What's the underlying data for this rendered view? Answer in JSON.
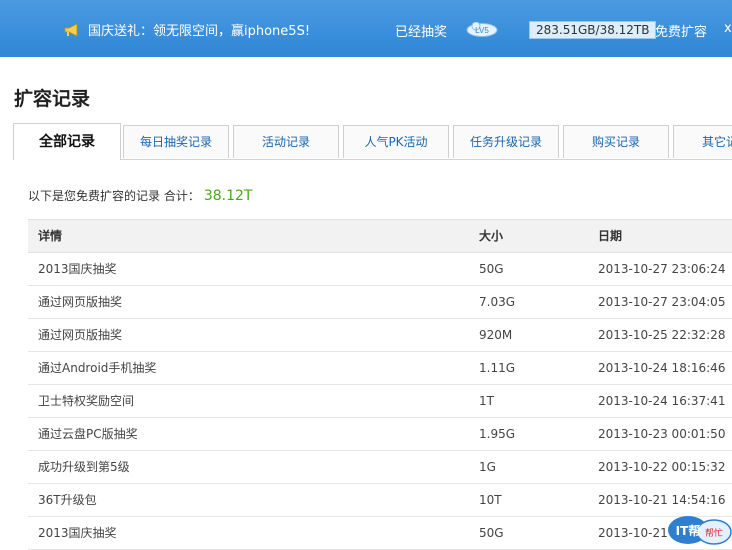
{
  "topbar": {
    "promo_text": "国庆送礼：领无限空间，赢iphone5S!",
    "lottery_done": "已经抽奖",
    "level": "LV5",
    "capacity": "283.51GB/38.12TB",
    "free_expand": "免费扩容",
    "user_partial": "x"
  },
  "page": {
    "title": "扩容记录"
  },
  "tabs": [
    {
      "label": "全部记录"
    },
    {
      "label": "每日抽奖记录"
    },
    {
      "label": "活动记录"
    },
    {
      "label": "人气PK活动"
    },
    {
      "label": "任务升级记录"
    },
    {
      "label": "购买记录"
    },
    {
      "label": "其它记"
    }
  ],
  "summary": {
    "text": "以下是您免费扩容的记录  合计：",
    "total": "38.12T"
  },
  "table": {
    "headers": [
      "详情",
      "大小",
      "日期"
    ],
    "rows": [
      {
        "detail": "2013国庆抽奖",
        "size": "50G",
        "date": "2013-10-27 23:06:24"
      },
      {
        "detail": "通过网页版抽奖",
        "size": "7.03G",
        "date": "2013-10-27 23:04:05"
      },
      {
        "detail": "通过网页版抽奖",
        "size": "920M",
        "date": "2013-10-25 22:32:28"
      },
      {
        "detail": "通过Android手机抽奖",
        "size": "1.11G",
        "date": "2013-10-24 18:16:46"
      },
      {
        "detail": "卫士特权奖励空间",
        "size": "1T",
        "date": "2013-10-24 16:37:41"
      },
      {
        "detail": "通过云盘PC版抽奖",
        "size": "1.95G",
        "date": "2013-10-23 00:01:50"
      },
      {
        "detail": "成功升级到第5级",
        "size": "1G",
        "date": "2013-10-22 00:15:32"
      },
      {
        "detail": "36T升级包",
        "size": "10T",
        "date": "2013-10-21 14:54:16"
      },
      {
        "detail": "2013国庆抽奖",
        "size": "50G",
        "date": "2013-10-21 14:5"
      }
    ]
  },
  "watermark": {
    "brand": "IT帮",
    "sub": "帮忙"
  },
  "colors": {
    "topbar": "#3b8fdb",
    "accent_total": "#4aa51d",
    "tab_link": "#1a66b0"
  }
}
